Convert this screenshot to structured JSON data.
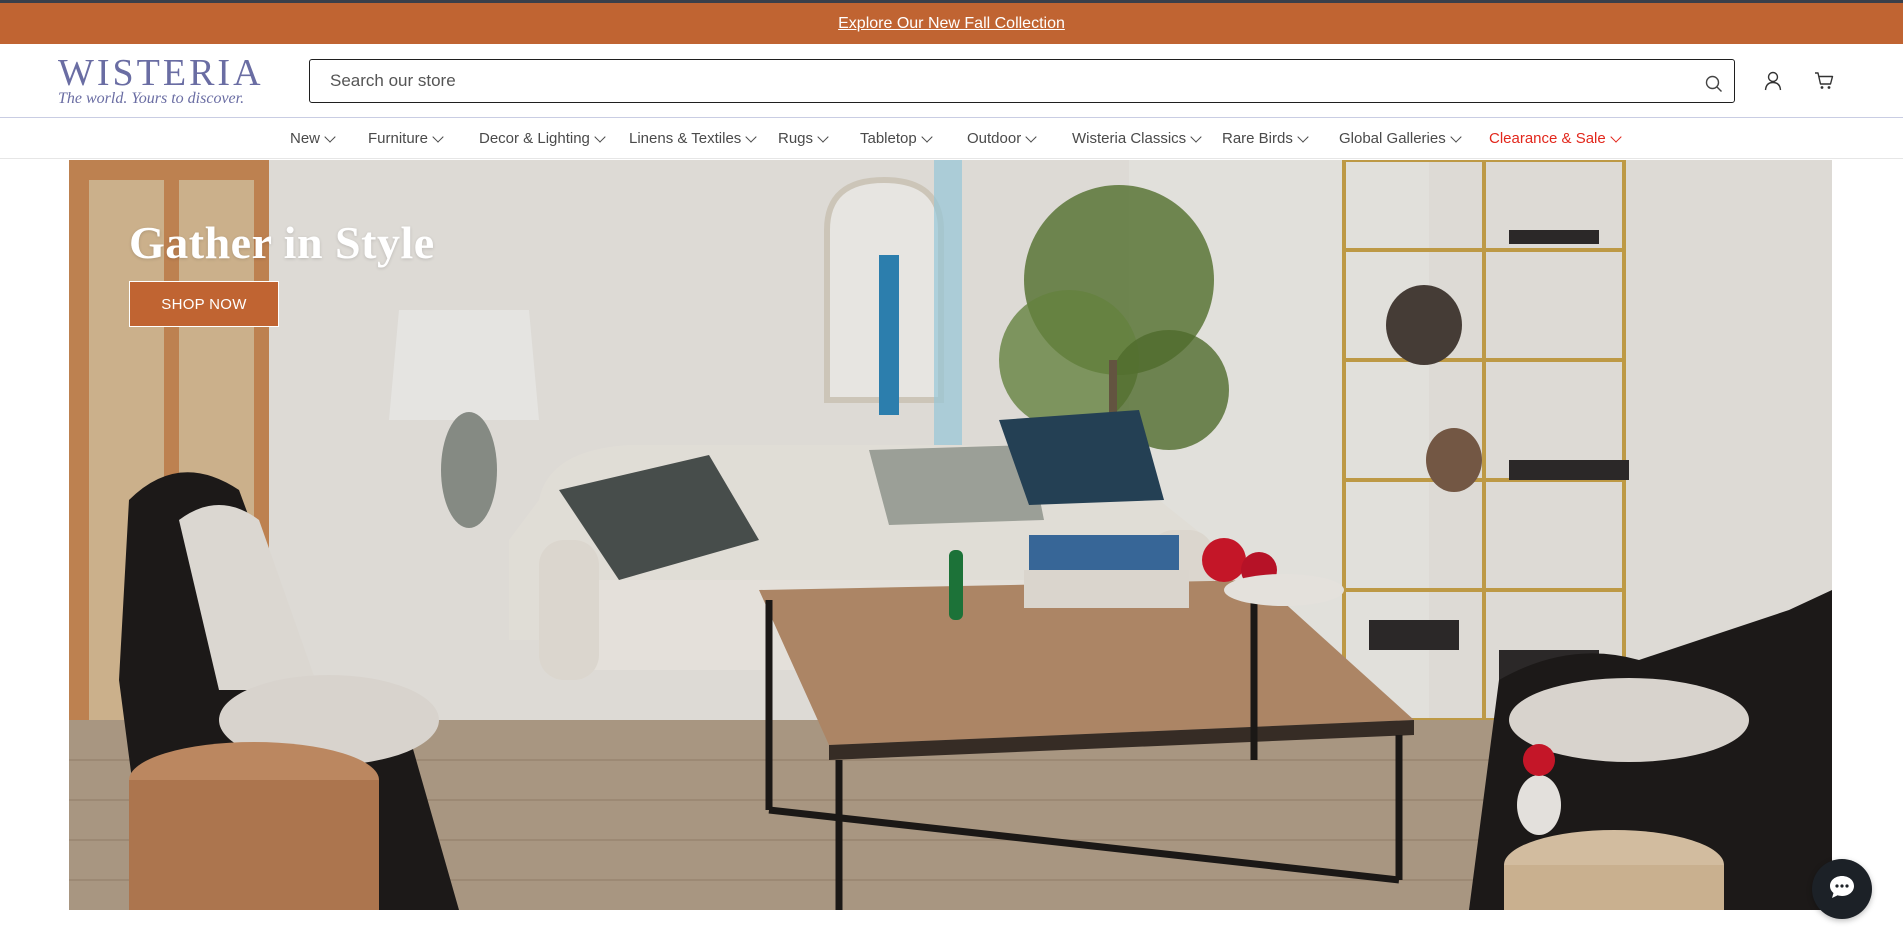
{
  "promo": {
    "text": "Explore Our New Fall Collection"
  },
  "logo": {
    "name": "WISTERIA",
    "tagline": "The world. Yours to discover."
  },
  "search": {
    "placeholder": "Search our store",
    "value": ""
  },
  "header_icons": {
    "search": "search-icon",
    "account": "user-icon",
    "cart": "cart-icon"
  },
  "nav": {
    "items": [
      {
        "label": "New"
      },
      {
        "label": "Furniture"
      },
      {
        "label": "Decor & Lighting"
      },
      {
        "label": "Linens & Textiles"
      },
      {
        "label": "Rugs"
      },
      {
        "label": "Tabletop"
      },
      {
        "label": "Outdoor"
      },
      {
        "label": "Wisteria Classics"
      },
      {
        "label": "Rare Birds"
      },
      {
        "label": "Global Galleries"
      },
      {
        "label": "Clearance & Sale"
      }
    ]
  },
  "hero": {
    "title": "Gather in Style",
    "cta": "SHOP NOW"
  },
  "chat": {
    "icon": "chat-icon"
  },
  "colors": {
    "brand_orange": "#c06432",
    "logo_purple": "#6a6da3",
    "sale_red": "#e2271c",
    "chat_bg": "#1c2127"
  }
}
